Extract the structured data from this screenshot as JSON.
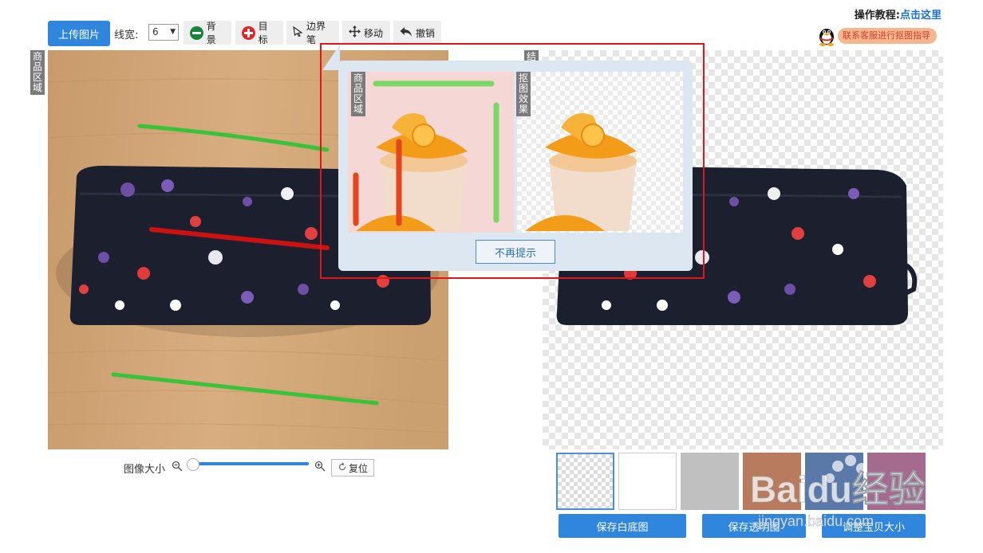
{
  "toolbar": {
    "upload_label": "上传图片",
    "line_width_label": "线宽:",
    "line_width_value": "6",
    "background_label": "背景",
    "target_label": "目标",
    "border_pen_label": "边界笔",
    "move_label": "移动",
    "undo_label": "撤销"
  },
  "help": {
    "prefix": "操作教程:",
    "link": "点击这里",
    "contact": "联系客服进行抠图指导"
  },
  "left_panel": {
    "tag": "商品区域"
  },
  "right_panel": {
    "tag": "结"
  },
  "popup": {
    "left_tag": "商品区域",
    "right_tag": "抠图效果",
    "dismiss_label": "不再提示"
  },
  "zoom": {
    "label": "图像大小",
    "value": 0.0,
    "reset_label": "复位"
  },
  "swatches": [
    {
      "name": "transparent",
      "color": "checker",
      "selected": true
    },
    {
      "name": "white",
      "color": "#ffffff",
      "selected": false
    },
    {
      "name": "gray",
      "color": "#c0c0c0",
      "selected": false
    },
    {
      "name": "brown",
      "color": "#b87b5e",
      "selected": false
    },
    {
      "name": "blue",
      "color": "#5a78a8",
      "selected": false
    },
    {
      "name": "mauve",
      "color": "#a46b8f",
      "selected": false
    }
  ],
  "actions": {
    "save_white": "保存白底图",
    "save_transparent": "保存透明图",
    "adjust_size": "调整宝贝大小"
  },
  "watermark": {
    "brand": "Baidu经验",
    "url": "jingyan.baidu.com"
  }
}
